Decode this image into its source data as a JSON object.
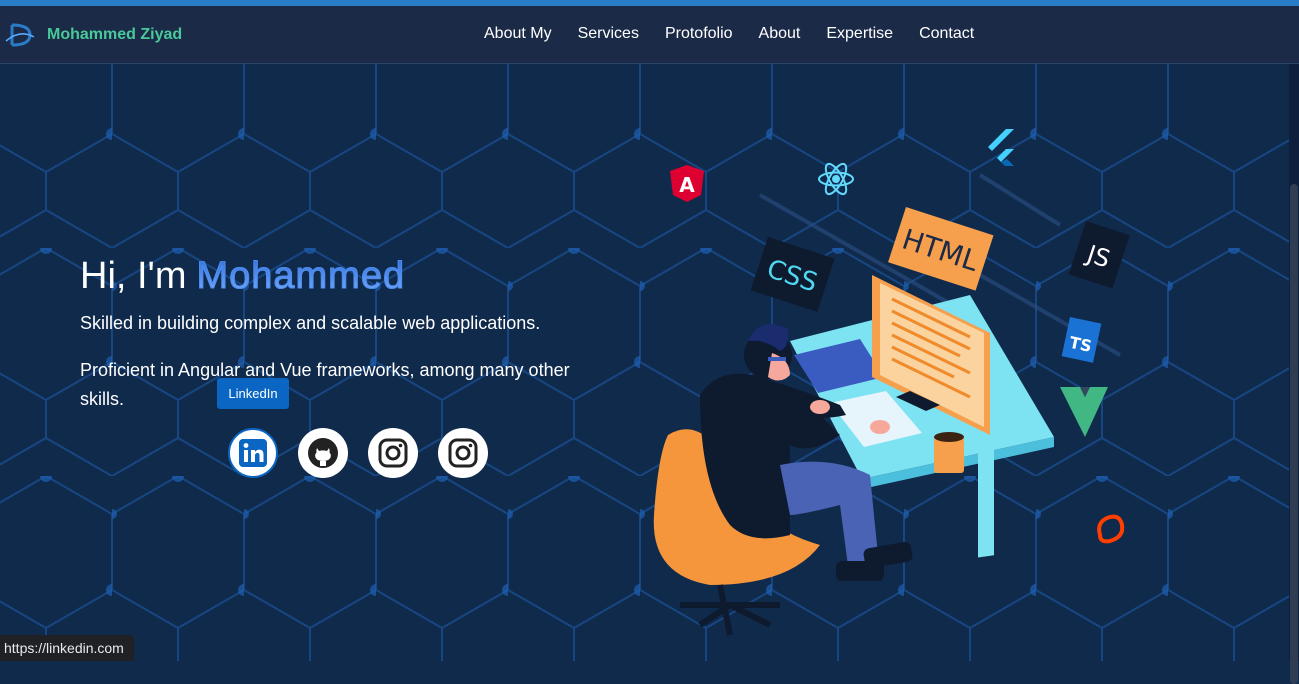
{
  "header": {
    "brand": "Mohammed Ziyad",
    "logo_icon": "d-swoosh-logo-icon",
    "nav": [
      {
        "label": "About My"
      },
      {
        "label": "Services"
      },
      {
        "label": "Protofolio"
      },
      {
        "label": "About"
      },
      {
        "label": "Expertise"
      },
      {
        "label": "Contact"
      }
    ]
  },
  "hero": {
    "greeting": "Hi, I'm",
    "name": "Mohammed",
    "line1": "Skilled in building complex and scalable web applications.",
    "line2": "Proficient in Angular and Vue frameworks, among many other skills.",
    "tooltip": "LinkedIn",
    "socials": [
      {
        "icon": "linkedin-icon"
      },
      {
        "icon": "github-icon"
      },
      {
        "icon": "instagram-icon"
      },
      {
        "icon": "instagram-icon"
      }
    ]
  },
  "illustration": {
    "labels": {
      "html": "HTML",
      "css": "CSS",
      "js": "JS",
      "ts": "TS"
    },
    "icons": [
      "angular-icon",
      "react-icon",
      "flutter-icon",
      "vue-icon",
      "svelte-icon"
    ]
  },
  "status_bar": {
    "url": "https://linkedin.com"
  },
  "colors": {
    "background": "#102a4c",
    "navbar": "#1b2a47",
    "brand": "#49c99a",
    "accent": "#2a7cc7",
    "linkedin": "#0a66c2"
  }
}
